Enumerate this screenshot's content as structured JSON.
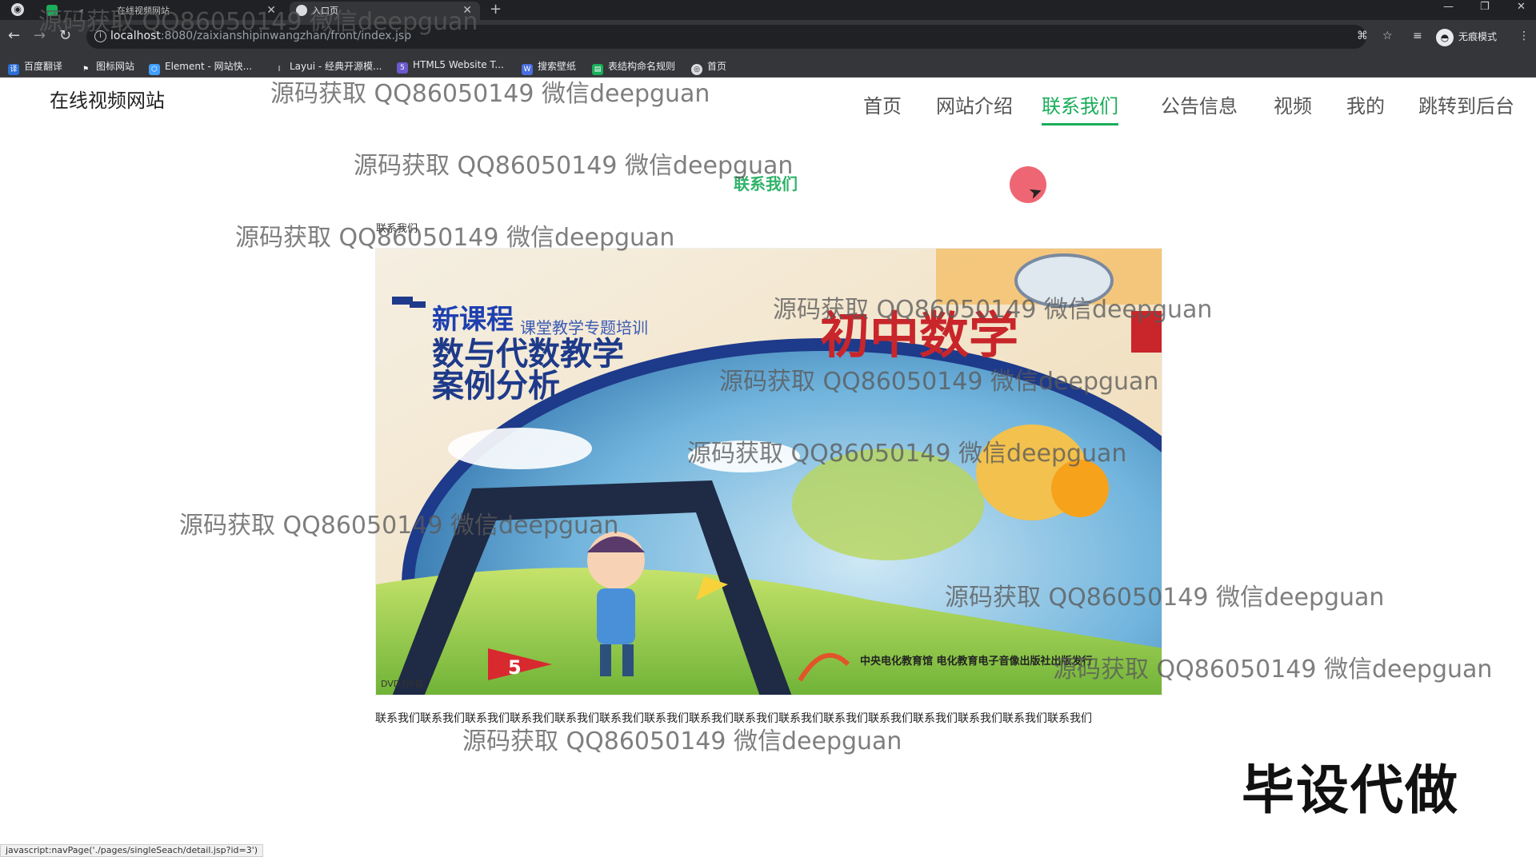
{
  "browser": {
    "tabs": [
      {
        "title": "在线视频网站",
        "active": false
      },
      {
        "title": "入口页",
        "active": true
      }
    ],
    "url_host": "localhost",
    "url_path": ":8080/zaixianshipinwangzhan/front/index.jsp",
    "incognito_label": "无痕模式",
    "bookmarks": [
      {
        "label": "百度翻译",
        "icon": "translate-icon",
        "color": "#2b6fd6"
      },
      {
        "label": "图标网站",
        "icon": "flag-icon",
        "color": "#35363a"
      },
      {
        "label": "Element - 网站快...",
        "icon": "element-icon",
        "color": "#409eff"
      },
      {
        "label": "Layui - 经典开源模...",
        "icon": "layui-icon",
        "color": "#35363a"
      },
      {
        "label": "HTML5 Website T...",
        "icon": "html5-icon",
        "color": "#6a5acd"
      },
      {
        "label": "搜索壁纸",
        "icon": "wallpaper-icon",
        "color": "#4a6ee0"
      },
      {
        "label": "表结构命名规则",
        "icon": "table-icon",
        "color": "#1aad5a"
      },
      {
        "label": "首页",
        "icon": "globe-icon",
        "color": "#35363a"
      }
    ]
  },
  "site": {
    "title": "在线视频网站",
    "nav": [
      {
        "label": "首页",
        "active": false
      },
      {
        "label": "网站介绍",
        "active": false
      },
      {
        "label": "联系我们",
        "active": true
      },
      {
        "label": "公告信息",
        "active": false
      },
      {
        "label": "视频",
        "active": false
      },
      {
        "label": "我的",
        "active": false
      },
      {
        "label": "跳转到后台",
        "active": false
      }
    ],
    "accent_color": "#1aad5a"
  },
  "page": {
    "heading": "联系我们",
    "article_title": "联系我们",
    "cover_image": {
      "label_small": "新课程",
      "subtitle": "课堂教学专题培训",
      "title_line1": "数与代数教学",
      "title_line2": "案例分析",
      "title_red": "初中数学",
      "corner_text": "DVD3片装",
      "publisher": "中央电化教育馆 电化教育电子音像出版社出版发行"
    },
    "body_text": "联系我们联系我们联系我们联系我们联系我们联系我们联系我们联系我们联系我们联系我们联系我们联系我们联系我们联系我们联系我们联系我们"
  },
  "status_bar_link": "javascript:navPage('./pages/singleSeach/detail.jsp?id=3')",
  "promo_text": "毕设代做",
  "watermark_text": "源码获取 QQ86050149 微信deepguan"
}
